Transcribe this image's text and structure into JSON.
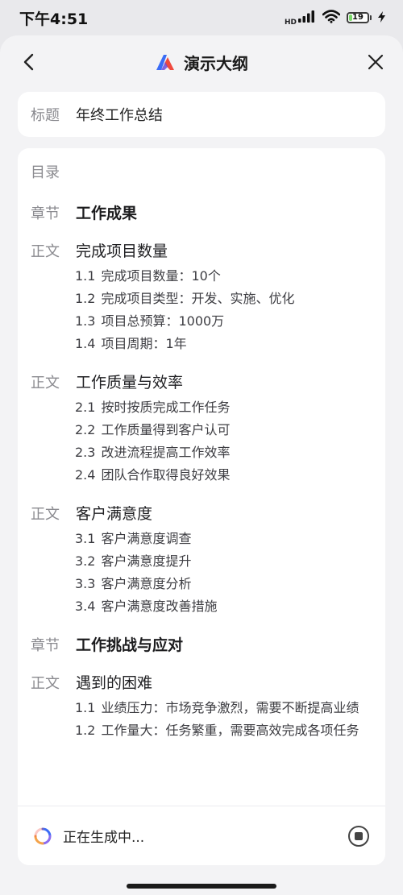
{
  "status_bar": {
    "time": "下午4:51",
    "network_label": "HD",
    "battery_level": "19",
    "battery_fraction": 0.19
  },
  "nav": {
    "title": "演示大纲",
    "icons": {
      "back": "chevron-left-icon",
      "close": "close-icon",
      "logo": "app-logo-icon"
    }
  },
  "title_field": {
    "label": "标题",
    "value": "年终工作总结"
  },
  "outline": {
    "heading": "目录",
    "chapter_label": "章节",
    "body_label": "正文",
    "chapters": [
      {
        "title": "工作成果",
        "sections": [
          {
            "title": "完成项目数量",
            "items": [
              {
                "num": "1.1",
                "text": "完成项目数量：10个"
              },
              {
                "num": "1.2",
                "text": "完成项目类型：开发、实施、优化"
              },
              {
                "num": "1.3",
                "text": "项目总预算：1000万"
              },
              {
                "num": "1.4",
                "text": "项目周期：1年"
              }
            ]
          },
          {
            "title": "工作质量与效率",
            "items": [
              {
                "num": "2.1",
                "text": "按时按质完成工作任务"
              },
              {
                "num": "2.2",
                "text": "工作质量得到客户认可"
              },
              {
                "num": "2.3",
                "text": "改进流程提高工作效率"
              },
              {
                "num": "2.4",
                "text": "团队合作取得良好效果"
              }
            ]
          },
          {
            "title": "客户满意度",
            "items": [
              {
                "num": "3.1",
                "text": "客户满意度调查"
              },
              {
                "num": "3.2",
                "text": "客户满意度提升"
              },
              {
                "num": "3.3",
                "text": "客户满意度分析"
              },
              {
                "num": "3.4",
                "text": "客户满意度改善措施"
              }
            ]
          }
        ]
      },
      {
        "title": "工作挑战与应对",
        "sections": [
          {
            "title": "遇到的困难",
            "items": [
              {
                "num": "1.1",
                "text": "业绩压力：市场竞争激烈，需要不断提高业绩"
              },
              {
                "num": "1.2",
                "text": "工作量大：任务繁重，需要高效完成各项任务"
              }
            ]
          }
        ]
      }
    ]
  },
  "footer": {
    "status_text": "正在生成中...",
    "icons": {
      "spinner": "loading-spinner-icon",
      "stop": "stop-icon"
    }
  },
  "colors": {
    "accent_blue": "#3b6cf6",
    "accent_red": "#f0493e",
    "battery_green": "#7bd86a"
  }
}
